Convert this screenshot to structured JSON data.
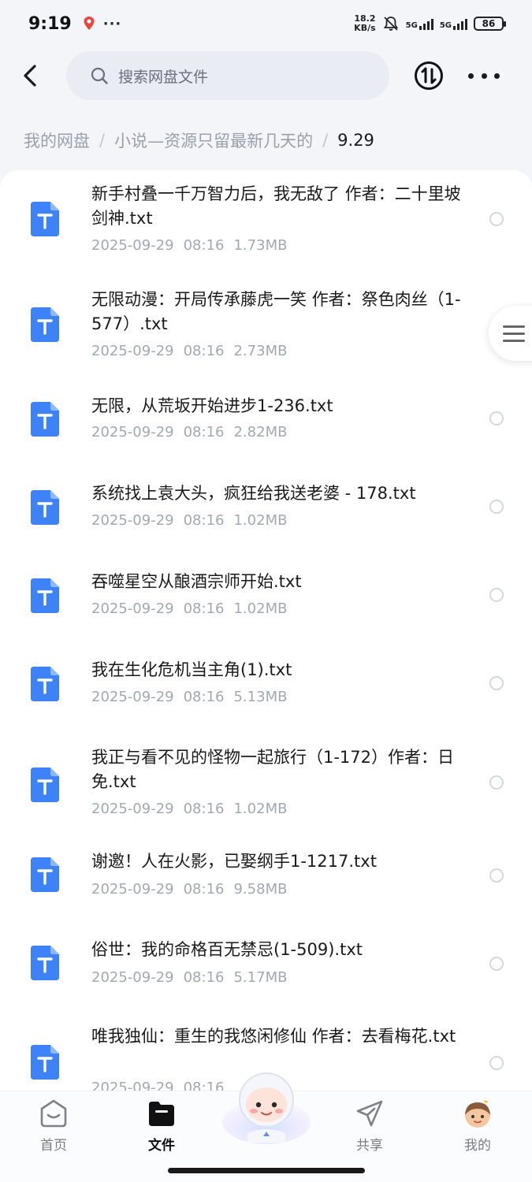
{
  "status": {
    "time": "9:19",
    "more": "···",
    "net_speed_value": "18.2",
    "net_speed_unit": "KB/s",
    "signal1": "5G",
    "signal2": "5G",
    "battery": "86"
  },
  "header": {
    "search_placeholder": "搜索网盘文件"
  },
  "breadcrumb": {
    "items": [
      "我的网盘",
      "小说—资源只留最新几天的"
    ],
    "separator": "/",
    "current": "9.29"
  },
  "files": [
    {
      "name": "新手村叠一千万智力后，我无敌了 作者：二十里坡剑神.txt",
      "date": "2025-09-29",
      "time": "08:16",
      "size": "1.73MB"
    },
    {
      "name": "无限动漫：开局传承藤虎一笑 作者：祭色肉丝（1-577）.txt",
      "date": "2025-09-29",
      "time": "08:16",
      "size": "2.73MB"
    },
    {
      "name": "无限，从荒坂开始进步1-236.txt",
      "date": "2025-09-29",
      "time": "08:16",
      "size": "2.82MB"
    },
    {
      "name": "系统找上袁大头，疯狂给我送老婆 - 178.txt",
      "date": "2025-09-29",
      "time": "08:16",
      "size": "1.02MB"
    },
    {
      "name": "吞噬星空从酿酒宗师开始.txt",
      "date": "2025-09-29",
      "time": "08:16",
      "size": "1.02MB"
    },
    {
      "name": "我在生化危机当主角(1).txt",
      "date": "2025-09-29",
      "time": "08:16",
      "size": "5.13MB"
    },
    {
      "name": "我正与看不见的怪物一起旅行（1-172）作者：日免.txt",
      "date": "2025-09-29",
      "time": "08:16",
      "size": "1.02MB"
    },
    {
      "name": "谢邀！人在火影，已娶纲手1-1217.txt",
      "date": "2025-09-29",
      "time": "08:16",
      "size": "9.58MB"
    },
    {
      "name": "俗世：我的命格百无禁忌(1-509).txt",
      "date": "2025-09-29",
      "time": "08:16",
      "size": "5.17MB"
    },
    {
      "name": "唯我独仙：重生的我悠闲修仙 作者：去看梅花.txt",
      "date": "2025-09-29",
      "time": "08:16",
      "size": ""
    }
  ],
  "tabs": {
    "home": "首页",
    "files": "文件",
    "share": "共享",
    "mine": "我的"
  },
  "icons": {
    "file": "txt-file-icon",
    "accent": "#3d82f6"
  }
}
